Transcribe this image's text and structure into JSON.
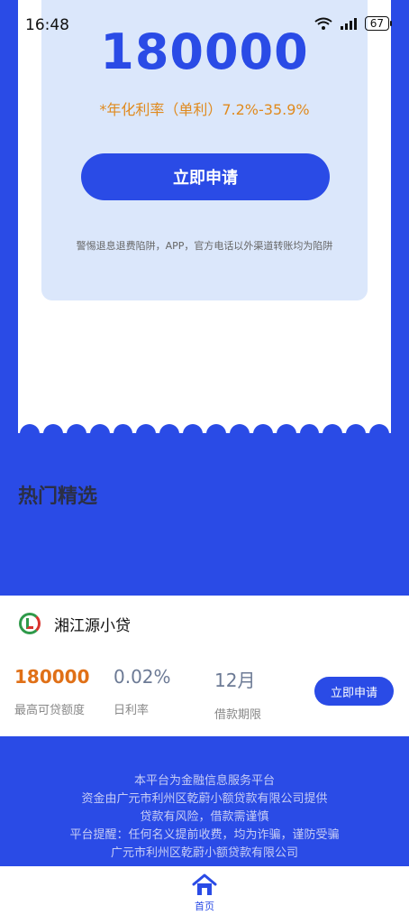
{
  "status": {
    "time": "16:48",
    "battery": "67"
  },
  "hero": {
    "amount": "180000",
    "rate": "*年化利率（单利）7.2%-35.9%",
    "apply_label": "立即申请",
    "warning": "警惕退息退费陷阱，APP，官方电话以外渠道转账均为陷阱"
  },
  "section": {
    "title": "热门精选"
  },
  "product": {
    "lender": "湘江源小贷",
    "stats": [
      {
        "value": "180000",
        "label": "最高可贷额度"
      },
      {
        "value": "0.02%",
        "label": "日利率"
      },
      {
        "value": "12月",
        "label": "借款期限"
      }
    ],
    "apply_label": "立即申请"
  },
  "disclaimer": {
    "lines": [
      "本平台为金融信息服务平台",
      "资金由广元市利州区乾蔚小额贷款有限公司提供",
      "贷款有风险，借款需谨慎",
      "平台提醒：任何名义提前收费，均为诈骗，谨防受骗",
      "广元市利州区乾蔚小额贷款有限公司"
    ]
  },
  "tabbar": {
    "home_label": "首页"
  },
  "colors": {
    "brand": "#2a4be6",
    "accent": "#e07017",
    "panel": "#dbe7fb"
  }
}
